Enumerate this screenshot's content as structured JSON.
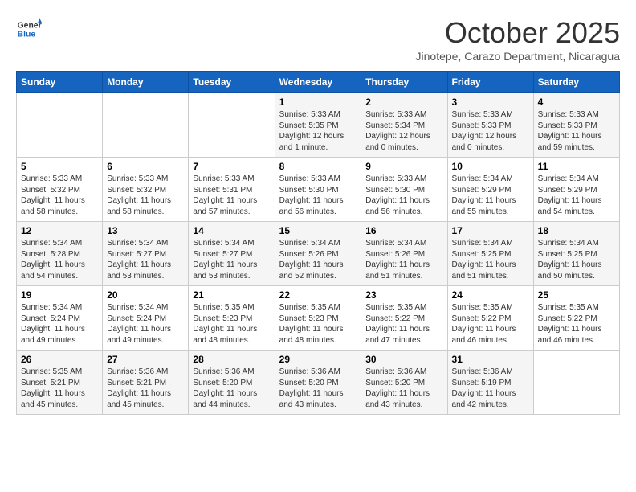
{
  "header": {
    "logo_general": "General",
    "logo_blue": "Blue",
    "month": "October 2025",
    "location": "Jinotepe, Carazo Department, Nicaragua"
  },
  "days_of_week": [
    "Sunday",
    "Monday",
    "Tuesday",
    "Wednesday",
    "Thursday",
    "Friday",
    "Saturday"
  ],
  "weeks": [
    [
      {
        "day": "",
        "content": ""
      },
      {
        "day": "",
        "content": ""
      },
      {
        "day": "",
        "content": ""
      },
      {
        "day": "1",
        "content": "Sunrise: 5:33 AM\nSunset: 5:35 PM\nDaylight: 12 hours\nand 1 minute."
      },
      {
        "day": "2",
        "content": "Sunrise: 5:33 AM\nSunset: 5:34 PM\nDaylight: 12 hours\nand 0 minutes."
      },
      {
        "day": "3",
        "content": "Sunrise: 5:33 AM\nSunset: 5:33 PM\nDaylight: 12 hours\nand 0 minutes."
      },
      {
        "day": "4",
        "content": "Sunrise: 5:33 AM\nSunset: 5:33 PM\nDaylight: 11 hours\nand 59 minutes."
      }
    ],
    [
      {
        "day": "5",
        "content": "Sunrise: 5:33 AM\nSunset: 5:32 PM\nDaylight: 11 hours\nand 58 minutes."
      },
      {
        "day": "6",
        "content": "Sunrise: 5:33 AM\nSunset: 5:32 PM\nDaylight: 11 hours\nand 58 minutes."
      },
      {
        "day": "7",
        "content": "Sunrise: 5:33 AM\nSunset: 5:31 PM\nDaylight: 11 hours\nand 57 minutes."
      },
      {
        "day": "8",
        "content": "Sunrise: 5:33 AM\nSunset: 5:30 PM\nDaylight: 11 hours\nand 56 minutes."
      },
      {
        "day": "9",
        "content": "Sunrise: 5:33 AM\nSunset: 5:30 PM\nDaylight: 11 hours\nand 56 minutes."
      },
      {
        "day": "10",
        "content": "Sunrise: 5:34 AM\nSunset: 5:29 PM\nDaylight: 11 hours\nand 55 minutes."
      },
      {
        "day": "11",
        "content": "Sunrise: 5:34 AM\nSunset: 5:29 PM\nDaylight: 11 hours\nand 54 minutes."
      }
    ],
    [
      {
        "day": "12",
        "content": "Sunrise: 5:34 AM\nSunset: 5:28 PM\nDaylight: 11 hours\nand 54 minutes."
      },
      {
        "day": "13",
        "content": "Sunrise: 5:34 AM\nSunset: 5:27 PM\nDaylight: 11 hours\nand 53 minutes."
      },
      {
        "day": "14",
        "content": "Sunrise: 5:34 AM\nSunset: 5:27 PM\nDaylight: 11 hours\nand 53 minutes."
      },
      {
        "day": "15",
        "content": "Sunrise: 5:34 AM\nSunset: 5:26 PM\nDaylight: 11 hours\nand 52 minutes."
      },
      {
        "day": "16",
        "content": "Sunrise: 5:34 AM\nSunset: 5:26 PM\nDaylight: 11 hours\nand 51 minutes."
      },
      {
        "day": "17",
        "content": "Sunrise: 5:34 AM\nSunset: 5:25 PM\nDaylight: 11 hours\nand 51 minutes."
      },
      {
        "day": "18",
        "content": "Sunrise: 5:34 AM\nSunset: 5:25 PM\nDaylight: 11 hours\nand 50 minutes."
      }
    ],
    [
      {
        "day": "19",
        "content": "Sunrise: 5:34 AM\nSunset: 5:24 PM\nDaylight: 11 hours\nand 49 minutes."
      },
      {
        "day": "20",
        "content": "Sunrise: 5:34 AM\nSunset: 5:24 PM\nDaylight: 11 hours\nand 49 minutes."
      },
      {
        "day": "21",
        "content": "Sunrise: 5:35 AM\nSunset: 5:23 PM\nDaylight: 11 hours\nand 48 minutes."
      },
      {
        "day": "22",
        "content": "Sunrise: 5:35 AM\nSunset: 5:23 PM\nDaylight: 11 hours\nand 48 minutes."
      },
      {
        "day": "23",
        "content": "Sunrise: 5:35 AM\nSunset: 5:22 PM\nDaylight: 11 hours\nand 47 minutes."
      },
      {
        "day": "24",
        "content": "Sunrise: 5:35 AM\nSunset: 5:22 PM\nDaylight: 11 hours\nand 46 minutes."
      },
      {
        "day": "25",
        "content": "Sunrise: 5:35 AM\nSunset: 5:22 PM\nDaylight: 11 hours\nand 46 minutes."
      }
    ],
    [
      {
        "day": "26",
        "content": "Sunrise: 5:35 AM\nSunset: 5:21 PM\nDaylight: 11 hours\nand 45 minutes."
      },
      {
        "day": "27",
        "content": "Sunrise: 5:36 AM\nSunset: 5:21 PM\nDaylight: 11 hours\nand 45 minutes."
      },
      {
        "day": "28",
        "content": "Sunrise: 5:36 AM\nSunset: 5:20 PM\nDaylight: 11 hours\nand 44 minutes."
      },
      {
        "day": "29",
        "content": "Sunrise: 5:36 AM\nSunset: 5:20 PM\nDaylight: 11 hours\nand 43 minutes."
      },
      {
        "day": "30",
        "content": "Sunrise: 5:36 AM\nSunset: 5:20 PM\nDaylight: 11 hours\nand 43 minutes."
      },
      {
        "day": "31",
        "content": "Sunrise: 5:36 AM\nSunset: 5:19 PM\nDaylight: 11 hours\nand 42 minutes."
      },
      {
        "day": "",
        "content": ""
      }
    ]
  ]
}
